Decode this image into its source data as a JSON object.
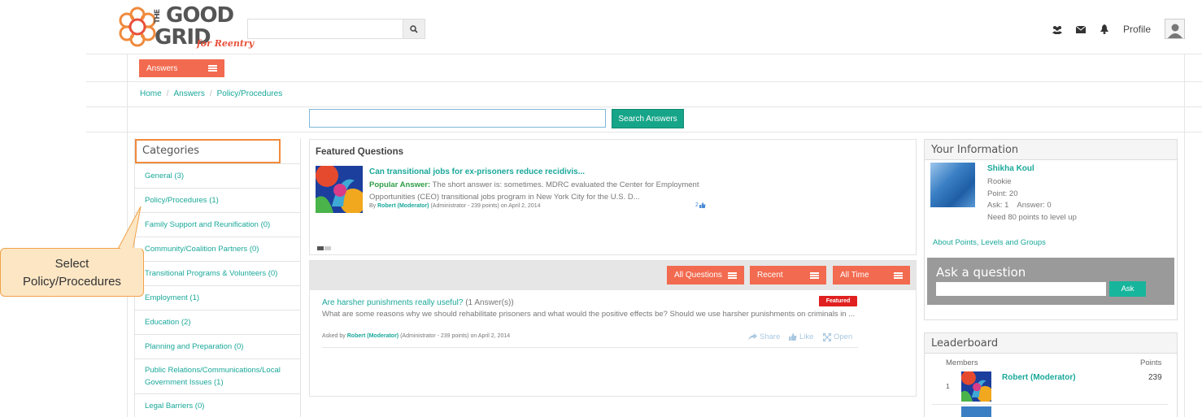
{
  "header": {
    "logo": {
      "the": "THE",
      "good": "GOOD",
      "grid": "GRID",
      "subtitle": "for Reentry"
    },
    "search_placeholder": "",
    "profile_label": "Profile",
    "icons": [
      "users-icon",
      "mail-icon",
      "bell-icon",
      "search-icon",
      "avatar-icon"
    ]
  },
  "subnav": {
    "answers_label": "Answers"
  },
  "breadcrumb": {
    "items": [
      "Home",
      "Answers",
      "Policy/Procedures"
    ]
  },
  "answer_search": {
    "placeholder": "",
    "button_label": "Search Answers"
  },
  "categories": {
    "title": "Categories",
    "items": [
      "General (3)",
      "Policy/Procedures (1)",
      "Family Support and Reunification (0)",
      "Community/Coalition Partners (0)",
      "Transitional Programs & Volunteers (0)",
      "Employment (1)",
      "Education (2)",
      "Planning and Preparation (0)",
      "Public Relations/Communications/Local Government Issues (1)",
      "Legal Barriers (0)"
    ]
  },
  "callout": {
    "line1": "Select",
    "line2": "Policy/Procedures"
  },
  "featured": {
    "title": "Featured Questions",
    "question": "Can transitional jobs for ex-prisoners reduce recidivis...",
    "answer_label": "Popular Answer:",
    "answer_text": " The short answer is: sometimes. MDRC evaluated the Center for Employment Opportunities (CEO) transitional jobs program in New York City for the U.S. D...",
    "by_prefix": "By",
    "author": "Robert (Moderator)",
    "author_meta": "(Administrator - 239 points)",
    "date": "on April 2, 2014",
    "likes": "2"
  },
  "filters": {
    "questions": "All Questions",
    "sort": "Recent",
    "time": "All Time"
  },
  "question": {
    "title": "Are harsher punishments really useful?",
    "answer_count": "(1 Answer(s))",
    "badge": "Featured",
    "body": "What are some reasons why we should rehabilitate prisoners and what would the positive effects be? Should we use harsher punishments on criminals in ...",
    "asked_prefix": "Asked by",
    "author": "Robert (Moderator)",
    "author_meta": "(Administrator - 239 points)",
    "date": "on April 2, 2014",
    "actions": {
      "share": "Share",
      "like": "Like",
      "open": "Open"
    }
  },
  "your_info": {
    "title": "Your Information",
    "name": "Shikha Koul",
    "level": "Rookie",
    "points": "Point: 20",
    "ask_answer": "Ask: 1    Answer: 0",
    "next_level": "Need 80 points to level up",
    "about_link": "About Points, Levels and Groups"
  },
  "ask": {
    "title": "Ask a question",
    "button": "Ask",
    "placeholder": ""
  },
  "leaderboard": {
    "title": "Leaderboard",
    "col_members": "Members",
    "col_points": "Points",
    "rows": [
      {
        "rank": "1",
        "name": "Robert (Moderator)",
        "points": "239"
      }
    ]
  },
  "colors": {
    "accent": "#f26a4f",
    "teal": "#1aa89a",
    "callout_bg": "#fde6c4",
    "callout_border": "#f0a24a"
  }
}
